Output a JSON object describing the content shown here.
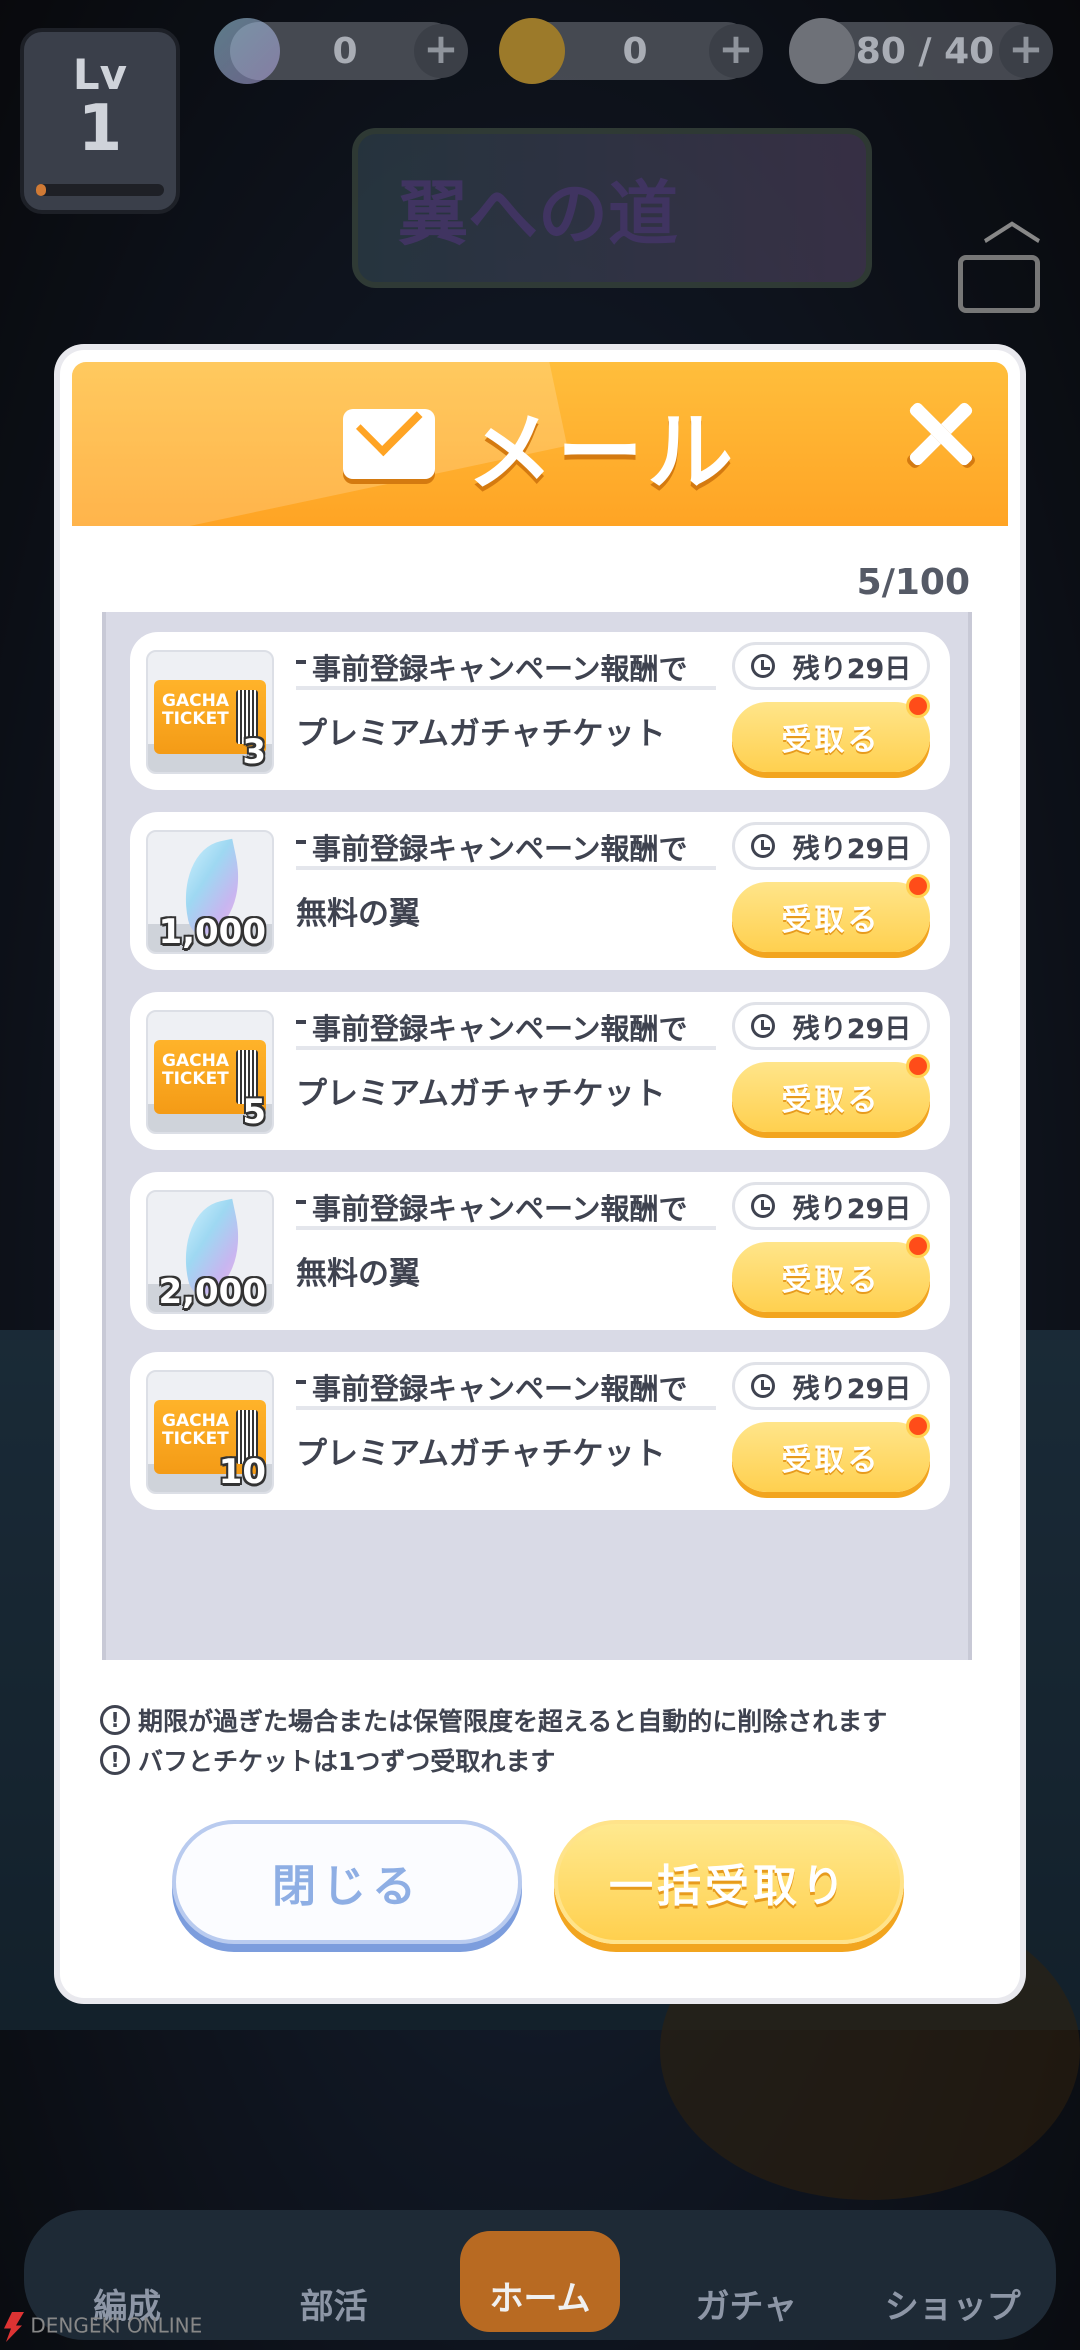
{
  "hud": {
    "level_label": "Lv",
    "level_value": "1",
    "level_progress": 0.08,
    "fins": "0",
    "coins": "0",
    "stamina": "80 / 40",
    "banner": "翼への道"
  },
  "tabs": [
    "編成",
    "部活",
    "ホーム",
    "ガチャ",
    "ショップ"
  ],
  "watermark": "DENGEKI ONLINE",
  "modal": {
    "title": "メール",
    "count": "5/100",
    "items": [
      {
        "type": "ticket",
        "title": "事前登録キャンペーン報酬で",
        "body": "プレミアムガチャチケット",
        "qty": "3",
        "remaining": "残り29日",
        "button": "受取る"
      },
      {
        "type": "fin",
        "title": "事前登録キャンペーン報酬で",
        "body": "無料の翼",
        "qty": "1,000",
        "remaining": "残り29日",
        "button": "受取る"
      },
      {
        "type": "ticket",
        "title": "事前登録キャンペーン報酬で",
        "body": "プレミアムガチャチケット",
        "qty": "5",
        "remaining": "残り29日",
        "button": "受取る"
      },
      {
        "type": "fin",
        "title": "事前登録キャンペーン報酬で",
        "body": "無料の翼",
        "qty": "2,000",
        "remaining": "残り29日",
        "button": "受取る"
      },
      {
        "type": "ticket",
        "title": "事前登録キャンペーン報酬で",
        "body": "プレミアムガチャチケット",
        "qty": "10",
        "remaining": "残り29日",
        "button": "受取る"
      }
    ],
    "ticket_label": "GACHA TICKET",
    "notes": [
      "期限が過ぎた場合または保管限度を超えると自動的に削除されます",
      "バフとチケットは1つずつ受取れます"
    ],
    "close_label": "閉じる",
    "receive_all_label": "一括受取り"
  },
  "colors": {
    "header": "#ffa424",
    "receive_button": "#ffd04f",
    "badge": "#ff4c19",
    "close_button_border": "#7c9ddd"
  }
}
